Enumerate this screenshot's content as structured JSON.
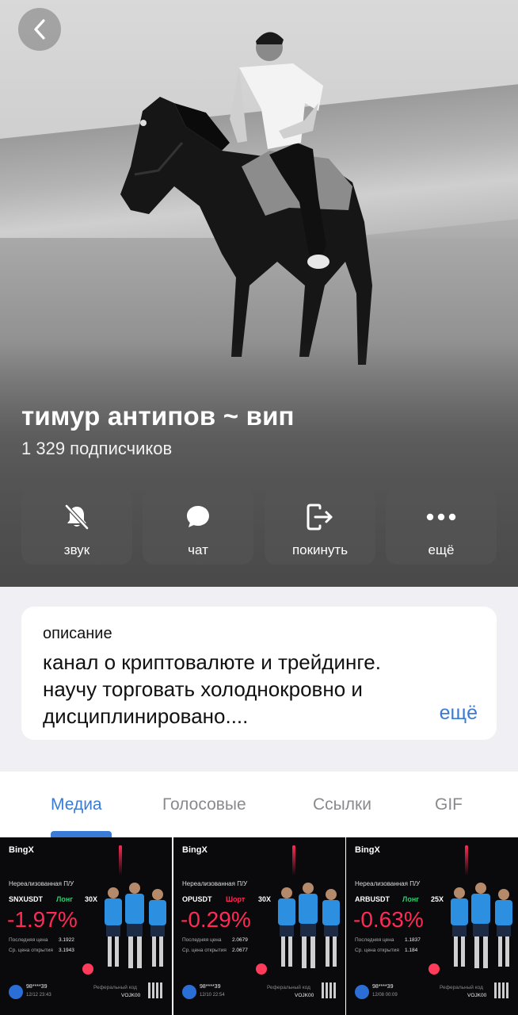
{
  "header": {
    "back_icon": "chevron-left-icon",
    "title": "тимур антипов ~ вип",
    "subscribers": "1 329 подписчиков"
  },
  "actions": [
    {
      "label": "звук",
      "icon": "bell-slash-icon"
    },
    {
      "label": "чат",
      "icon": "chat-bubble-icon"
    },
    {
      "label": "покинуть",
      "icon": "leave-icon"
    },
    {
      "label": "ещё",
      "icon": "more-dots-icon"
    }
  ],
  "description": {
    "label": "описание",
    "text_line1": "канал о криптовалюте и трейдинге.",
    "text_line2": "научу торговать холоднокровно и",
    "text_line3": "дисциплинировано....",
    "more": "ещё"
  },
  "tabs": [
    {
      "label": "Медиа",
      "active": true
    },
    {
      "label": "Голосовые",
      "active": false
    },
    {
      "label": "Ссылки",
      "active": false
    },
    {
      "label": "GIF",
      "active": false
    }
  ],
  "media": [
    {
      "brand": "BingX",
      "title": "Нереализованная П/У",
      "pair": "SNXUSDT",
      "side": "Лонг",
      "leverage": "30X",
      "pnl": "-1.97%",
      "last_label": "Последняя цена",
      "last_value": "3.1922",
      "open_label": "Ср. цена открытия",
      "open_value": "3.1943",
      "user": "98****39",
      "date": "12/12 23:43",
      "ref_label": "Реферальный код",
      "ref_code": "VOJK00"
    },
    {
      "brand": "BingX",
      "title": "Нереализованная П/У",
      "pair": "OPUSDT",
      "side": "Шорт",
      "leverage": "30X",
      "pnl": "-0.29%",
      "last_label": "Последняя цена",
      "last_value": "2.0679",
      "open_label": "Ср. цена открытия",
      "open_value": "2.0677",
      "user": "98****39",
      "date": "12/10 22:54",
      "ref_label": "Реферальный код",
      "ref_code": "VOJK00"
    },
    {
      "brand": "BingX",
      "title": "Нереализованная П/У",
      "pair": "ARBUSDT",
      "side": "Лонг",
      "leverage": "25X",
      "pnl": "-0.63%",
      "last_label": "Последняя цена",
      "last_value": "1.1837",
      "open_label": "Ср. цена открытия",
      "open_value": "1.184",
      "user": "98****39",
      "date": "12/08 00:09",
      "ref_label": "Реферальный код",
      "ref_code": "VOJK00"
    }
  ],
  "colors": {
    "accent": "#3a7bd5",
    "long": "#2ecc71",
    "short": "#ff2a55",
    "pnl_negative": "#ff2a55"
  }
}
